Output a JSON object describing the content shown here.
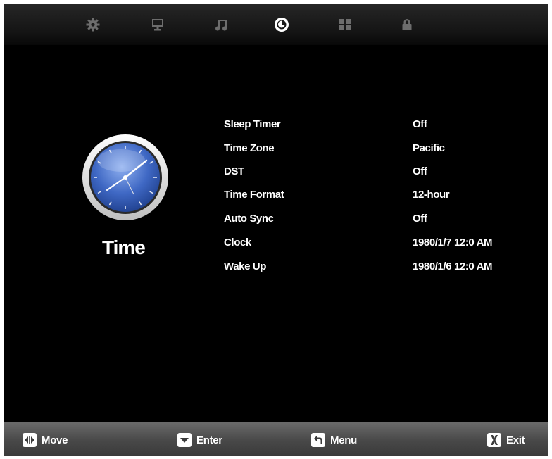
{
  "tabs": [
    {
      "icon": "gear-icon",
      "active": false
    },
    {
      "icon": "monitor-icon",
      "active": false
    },
    {
      "icon": "music-note-icon",
      "active": false
    },
    {
      "icon": "clock-icon",
      "active": true
    },
    {
      "icon": "grid-icon",
      "active": false
    },
    {
      "icon": "lock-icon",
      "active": false
    }
  ],
  "section": {
    "title": "Time",
    "icon": "analog-clock-icon"
  },
  "settings": [
    {
      "label": "Sleep Timer",
      "value": "Off"
    },
    {
      "label": "Time Zone",
      "value": "Pacific"
    },
    {
      "label": "DST",
      "value": "Off"
    },
    {
      "label": "Time Format",
      "value": "12-hour"
    },
    {
      "label": "Auto Sync",
      "value": "Off"
    },
    {
      "label": "Clock",
      "value": "1980/1/7 12:0 AM"
    },
    {
      "label": "Wake Up",
      "value": "1980/1/6 12:0 AM"
    }
  ],
  "footer": {
    "move_label": "Move",
    "enter_label": "Enter",
    "menu_label": "Menu",
    "exit_label": "Exit"
  },
  "colors": {
    "background": "#000000",
    "text": "#ffffff",
    "tab_inactive": "#6d6d6d",
    "clock_face": "#3f68c4",
    "footer_bar": "#4e4e4e"
  }
}
